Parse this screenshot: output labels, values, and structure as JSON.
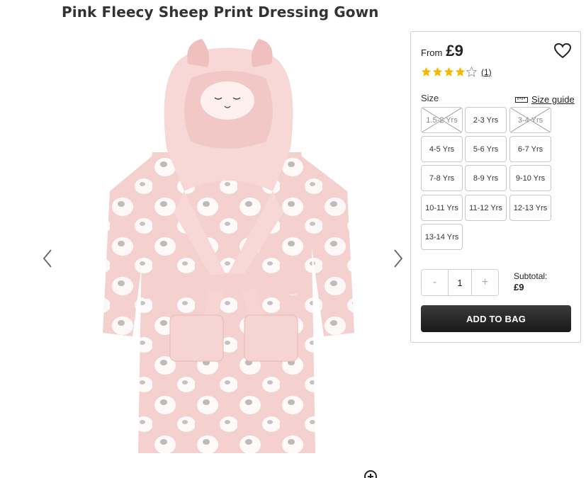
{
  "product": {
    "title": "Pink Fleecy Sheep Print Dressing Gown"
  },
  "gallery": {
    "prev_icon": "chevron-left-icon",
    "next_icon": "chevron-right-icon",
    "zoom_icon": "zoom-in-icon"
  },
  "price": {
    "from_label": "From",
    "value": "£9"
  },
  "wishlist": {
    "icon": "heart-outline-icon"
  },
  "rating": {
    "stars": 4,
    "max_stars": 5,
    "review_count": "(1)",
    "star_color": "#f5b800"
  },
  "size": {
    "label": "Size",
    "guide_label": "Size guide",
    "guide_icon": "ruler-icon",
    "options": [
      {
        "label": "1.5-2 Yrs",
        "available": false
      },
      {
        "label": "2-3 Yrs",
        "available": true
      },
      {
        "label": "3-4 Yrs",
        "available": false
      },
      {
        "label": "4-5 Yrs",
        "available": true
      },
      {
        "label": "5-6 Yrs",
        "available": true
      },
      {
        "label": "6-7 Yrs",
        "available": true
      },
      {
        "label": "7-8 Yrs",
        "available": true
      },
      {
        "label": "8-9 Yrs",
        "available": true
      },
      {
        "label": "9-10 Yrs",
        "available": true
      },
      {
        "label": "10-11 Yrs",
        "available": true
      },
      {
        "label": "11-12 Yrs",
        "available": true
      },
      {
        "label": "12-13 Yrs",
        "available": true
      },
      {
        "label": "13-14 Yrs",
        "available": true
      }
    ]
  },
  "quantity": {
    "minus_label": "-",
    "value": "1",
    "plus_label": "+"
  },
  "subtotal": {
    "label": "Subtotal:",
    "value": "£9"
  },
  "cart": {
    "add_label": "ADD TO BAG",
    "button_color": "#222222"
  }
}
